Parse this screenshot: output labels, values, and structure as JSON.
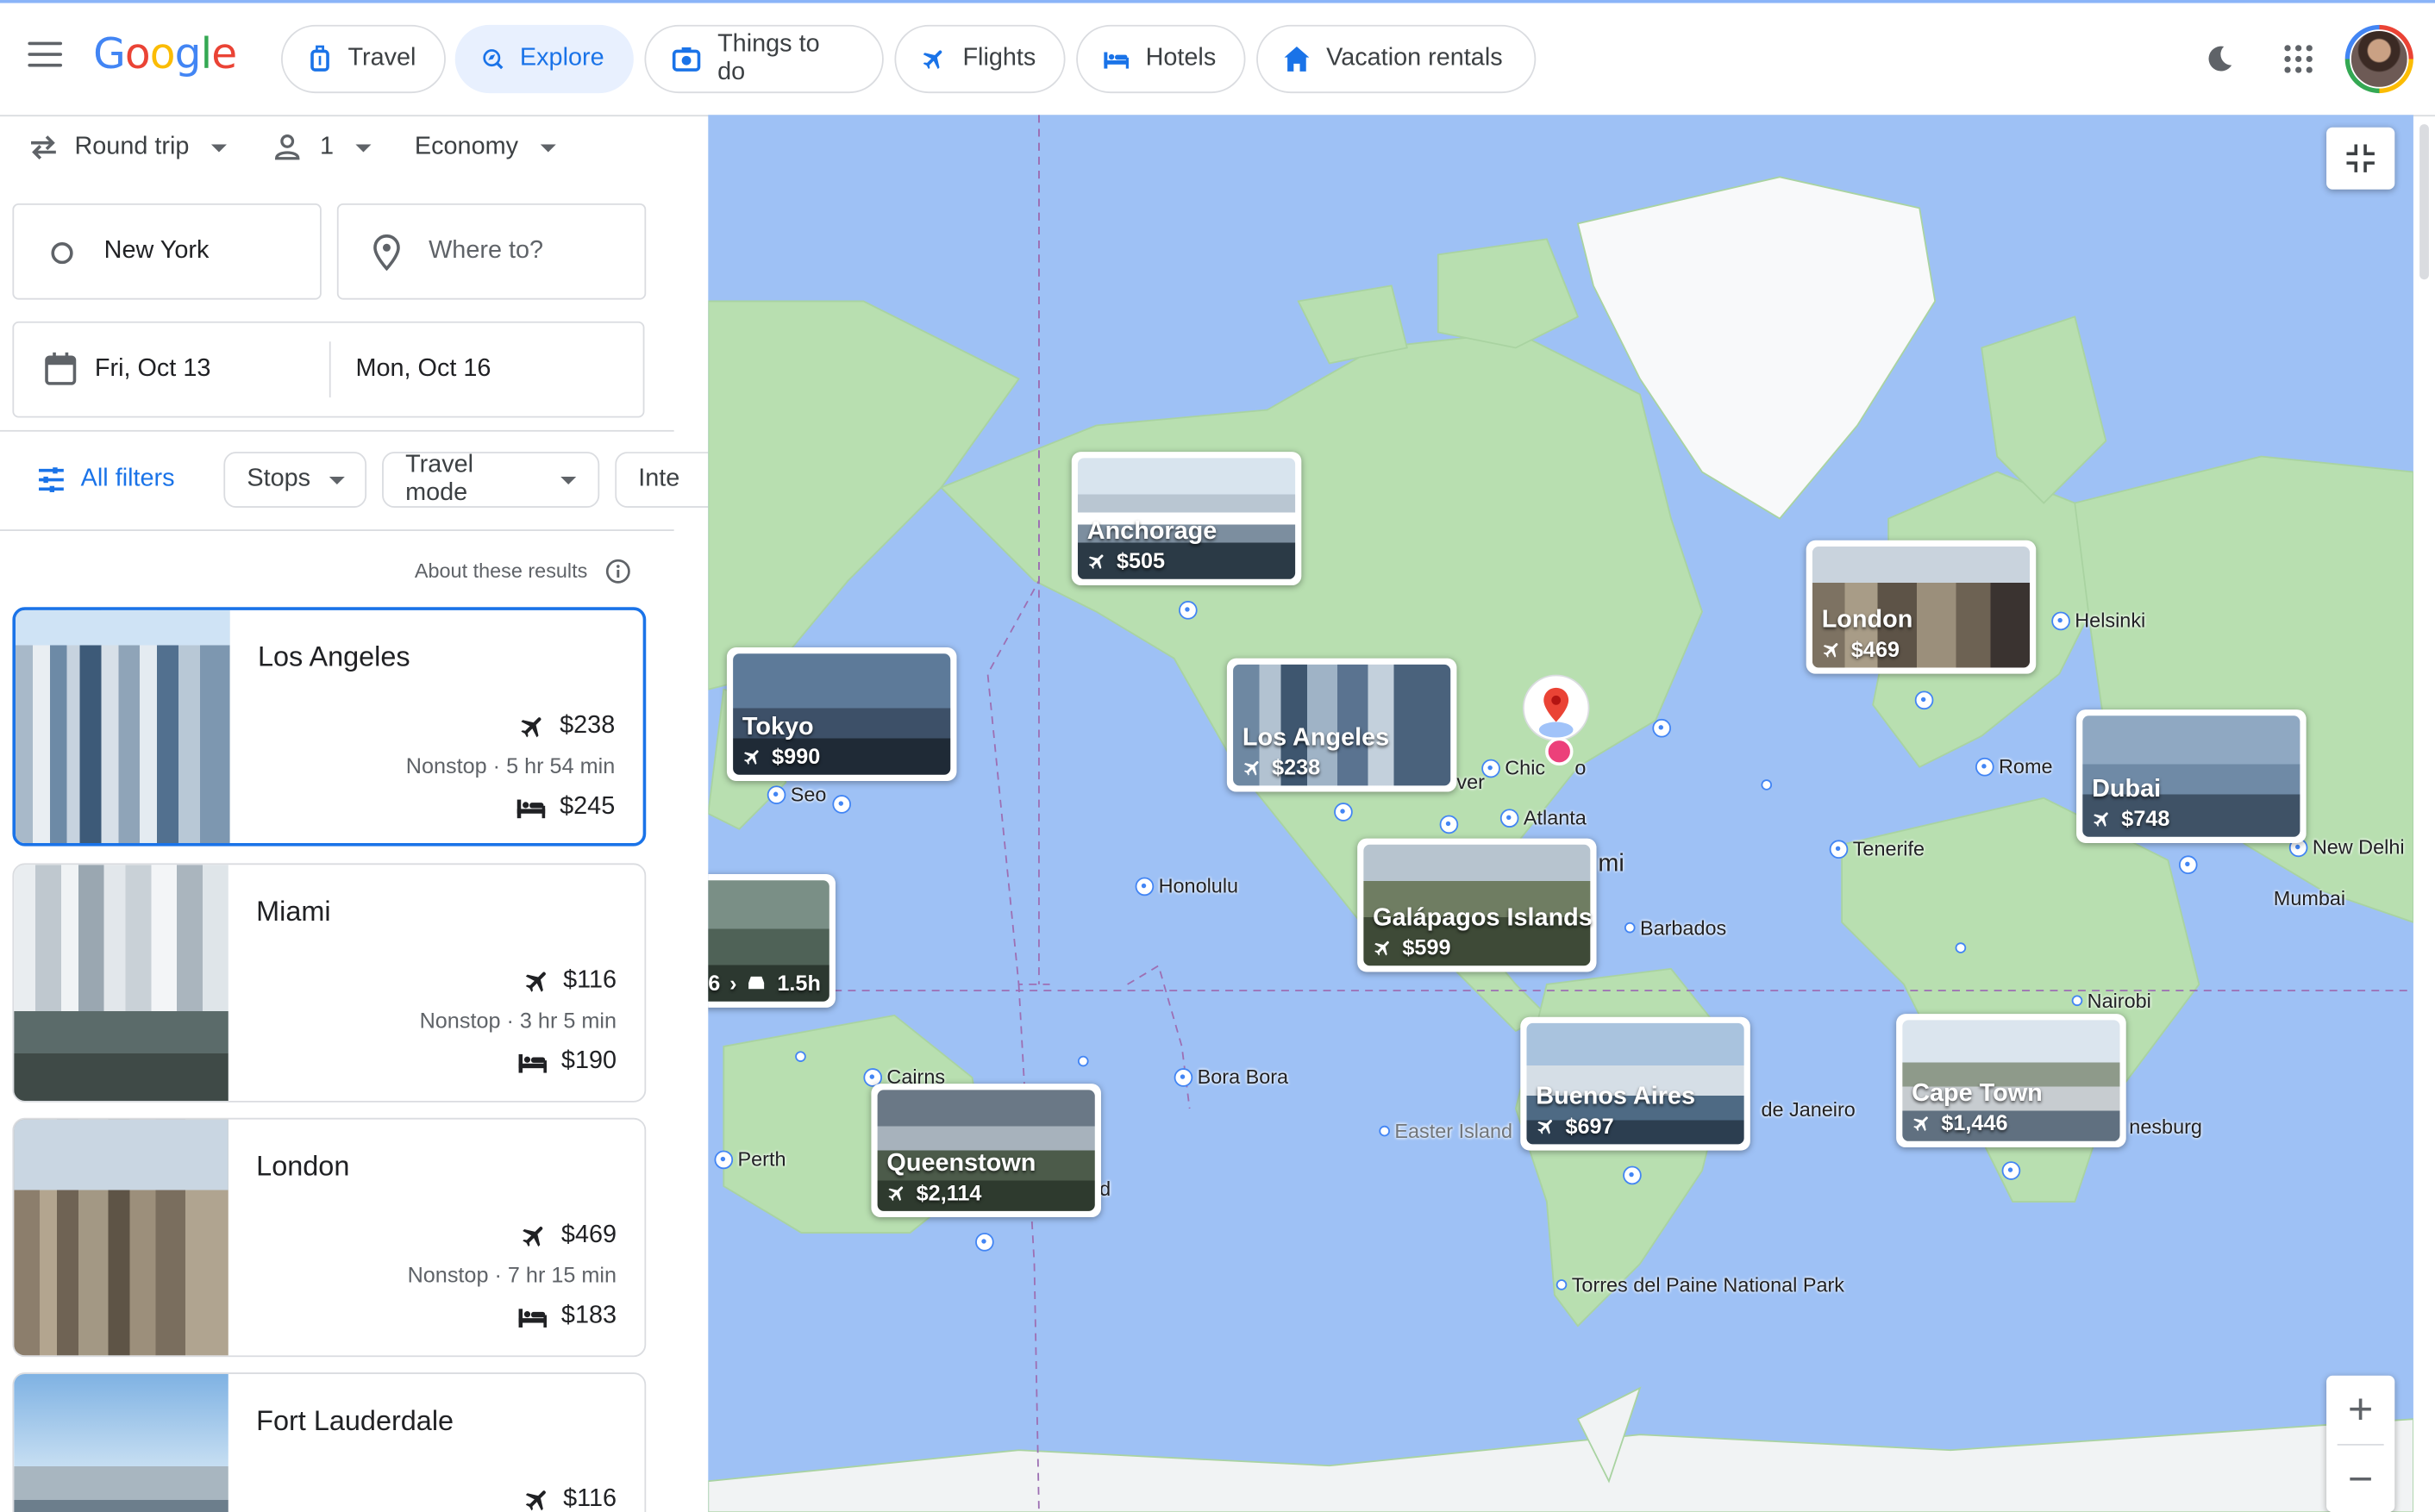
{
  "header": {
    "logo": "Google",
    "tabs": [
      {
        "label": "Travel",
        "icon": "travel-bag-icon"
      },
      {
        "label": "Explore",
        "icon": "explore-icon",
        "active": true
      },
      {
        "label": "Things to do",
        "icon": "camera-icon"
      },
      {
        "label": "Flights",
        "icon": "airplane-icon"
      },
      {
        "label": "Hotels",
        "icon": "bed-icon"
      },
      {
        "label": "Vacation rentals",
        "icon": "house-icon"
      }
    ],
    "accent_color": "#1a73e8"
  },
  "search": {
    "trip_type": "Round trip",
    "passengers": "1",
    "cabin": "Economy",
    "origin": "New York",
    "destination_placeholder": "Where to?",
    "depart_date": "Fri, Oct 13",
    "return_date": "Mon, Oct 16"
  },
  "filters": {
    "all_filters": "All filters",
    "stops": "Stops",
    "travel_mode": "Travel mode",
    "interests": "Inte"
  },
  "results": {
    "about": "About these results",
    "items": [
      {
        "city": "Los Angeles",
        "flight_price": "$238",
        "flight_meta": "Nonstop · 5 hr 54 min",
        "hotel_price": "$245"
      },
      {
        "city": "Miami",
        "flight_price": "$116",
        "flight_meta": "Nonstop · 3 hr 5 min",
        "hotel_price": "$190"
      },
      {
        "city": "London",
        "flight_price": "$469",
        "flight_meta": "Nonstop · 7 hr 15 min",
        "hotel_price": "$183"
      },
      {
        "city": "Fort Lauderdale",
        "flight_price": "$116"
      }
    ]
  },
  "map": {
    "cards": [
      {
        "name": "Anchorage",
        "price": "$505"
      },
      {
        "name": "Tokyo",
        "price": "$990"
      },
      {
        "name": "Los Angeles",
        "price": "$238"
      },
      {
        "name": "London",
        "price": "$469"
      },
      {
        "name": "Dubai",
        "price": "$748"
      },
      {
        "name": "Galápagos Islands",
        "price": "$599"
      },
      {
        "name": "Buenos Aires",
        "price": "$697"
      },
      {
        "name": "Cape Town",
        "price": "$1,446"
      },
      {
        "name": "Queenstown",
        "price": "$2,114"
      }
    ],
    "partial_card": {
      "price": "6",
      "duration": "1.5h"
    },
    "labels": [
      "Helsinki",
      "Rome",
      "Tenerife",
      "New Delhi",
      "Mumbai",
      "Nairobi",
      "nesburg",
      "Seo",
      "Honolulu",
      "Chic",
      "o",
      "Atlanta",
      "mi",
      "Barbados",
      "ver",
      "Bora Bora",
      "Cairns",
      "Perth",
      "Easter Island",
      "de Janeiro",
      "Torres del Paine National Park",
      "d"
    ]
  }
}
